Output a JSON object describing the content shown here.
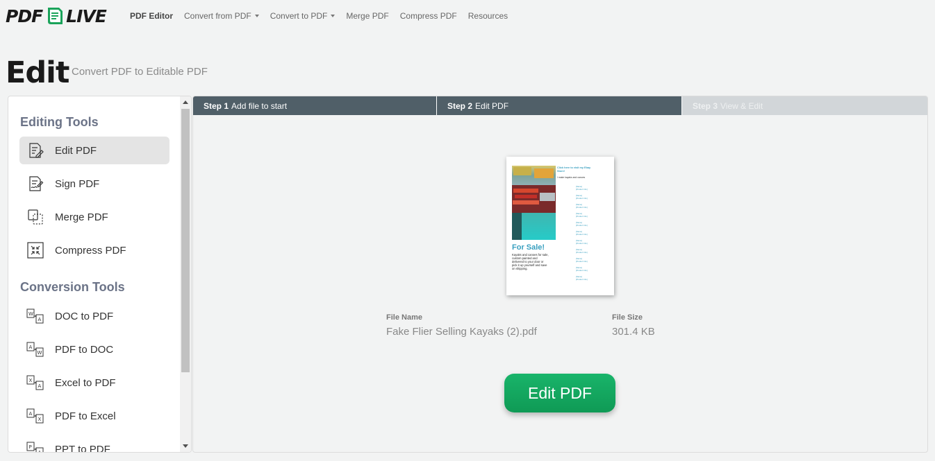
{
  "brand": {
    "left": "PDF",
    "right": "LIVE",
    "accent": "#1aa35a"
  },
  "nav": {
    "items": [
      {
        "label": "PDF Editor",
        "dropdown": false
      },
      {
        "label": "Convert from PDF",
        "dropdown": true
      },
      {
        "label": "Convert to PDF",
        "dropdown": true
      },
      {
        "label": "Merge PDF",
        "dropdown": false
      },
      {
        "label": "Compress PDF",
        "dropdown": false
      },
      {
        "label": "Resources",
        "dropdown": false
      }
    ]
  },
  "page": {
    "title": "Edit",
    "subtitle": "Convert PDF to Editable PDF"
  },
  "sidebar": {
    "editing_title": "Editing Tools",
    "editing_items": [
      {
        "label": "Edit PDF",
        "icon": "edit-pdf-icon",
        "active": true
      },
      {
        "label": "Sign PDF",
        "icon": "sign-pdf-icon",
        "active": false
      },
      {
        "label": "Merge PDF",
        "icon": "merge-pdf-icon",
        "active": false
      },
      {
        "label": "Compress PDF",
        "icon": "compress-pdf-icon",
        "active": false
      }
    ],
    "conversion_title": "Conversion Tools",
    "conversion_items": [
      {
        "label": "DOC to PDF",
        "icon": "doc-to-pdf-icon"
      },
      {
        "label": "PDF to DOC",
        "icon": "pdf-to-doc-icon"
      },
      {
        "label": "Excel to PDF",
        "icon": "excel-to-pdf-icon"
      },
      {
        "label": "PDF to Excel",
        "icon": "pdf-to-excel-icon"
      },
      {
        "label": "PPT to PDF",
        "icon": "ppt-to-pdf-icon"
      }
    ]
  },
  "steps": [
    {
      "num": "Step 1",
      "label": "Add file to start",
      "state": "done"
    },
    {
      "num": "Step 2",
      "label": "Edit PDF",
      "state": "current"
    },
    {
      "num": "Step 3",
      "label": "View & Edit",
      "state": "upcoming"
    }
  ],
  "file": {
    "name_label": "File Name",
    "name": "Fake Flier Selling Kayaks (2).pdf",
    "size_label": "File Size",
    "size": "301.4 KB"
  },
  "preview": {
    "heading": "For Sale!",
    "body": "Kayaks and canoes for sale, custom painted and delivered to your door or pick it up yourself and save on shipping.",
    "side_title": "Click here to visit my Ebay Store!",
    "side_sub": "I make kayaks and canoes"
  },
  "action": {
    "label": "Edit PDF"
  },
  "colors": {
    "step_active": "#505f68",
    "step_inactive": "#d2d6d9",
    "button": "#12a55e"
  }
}
